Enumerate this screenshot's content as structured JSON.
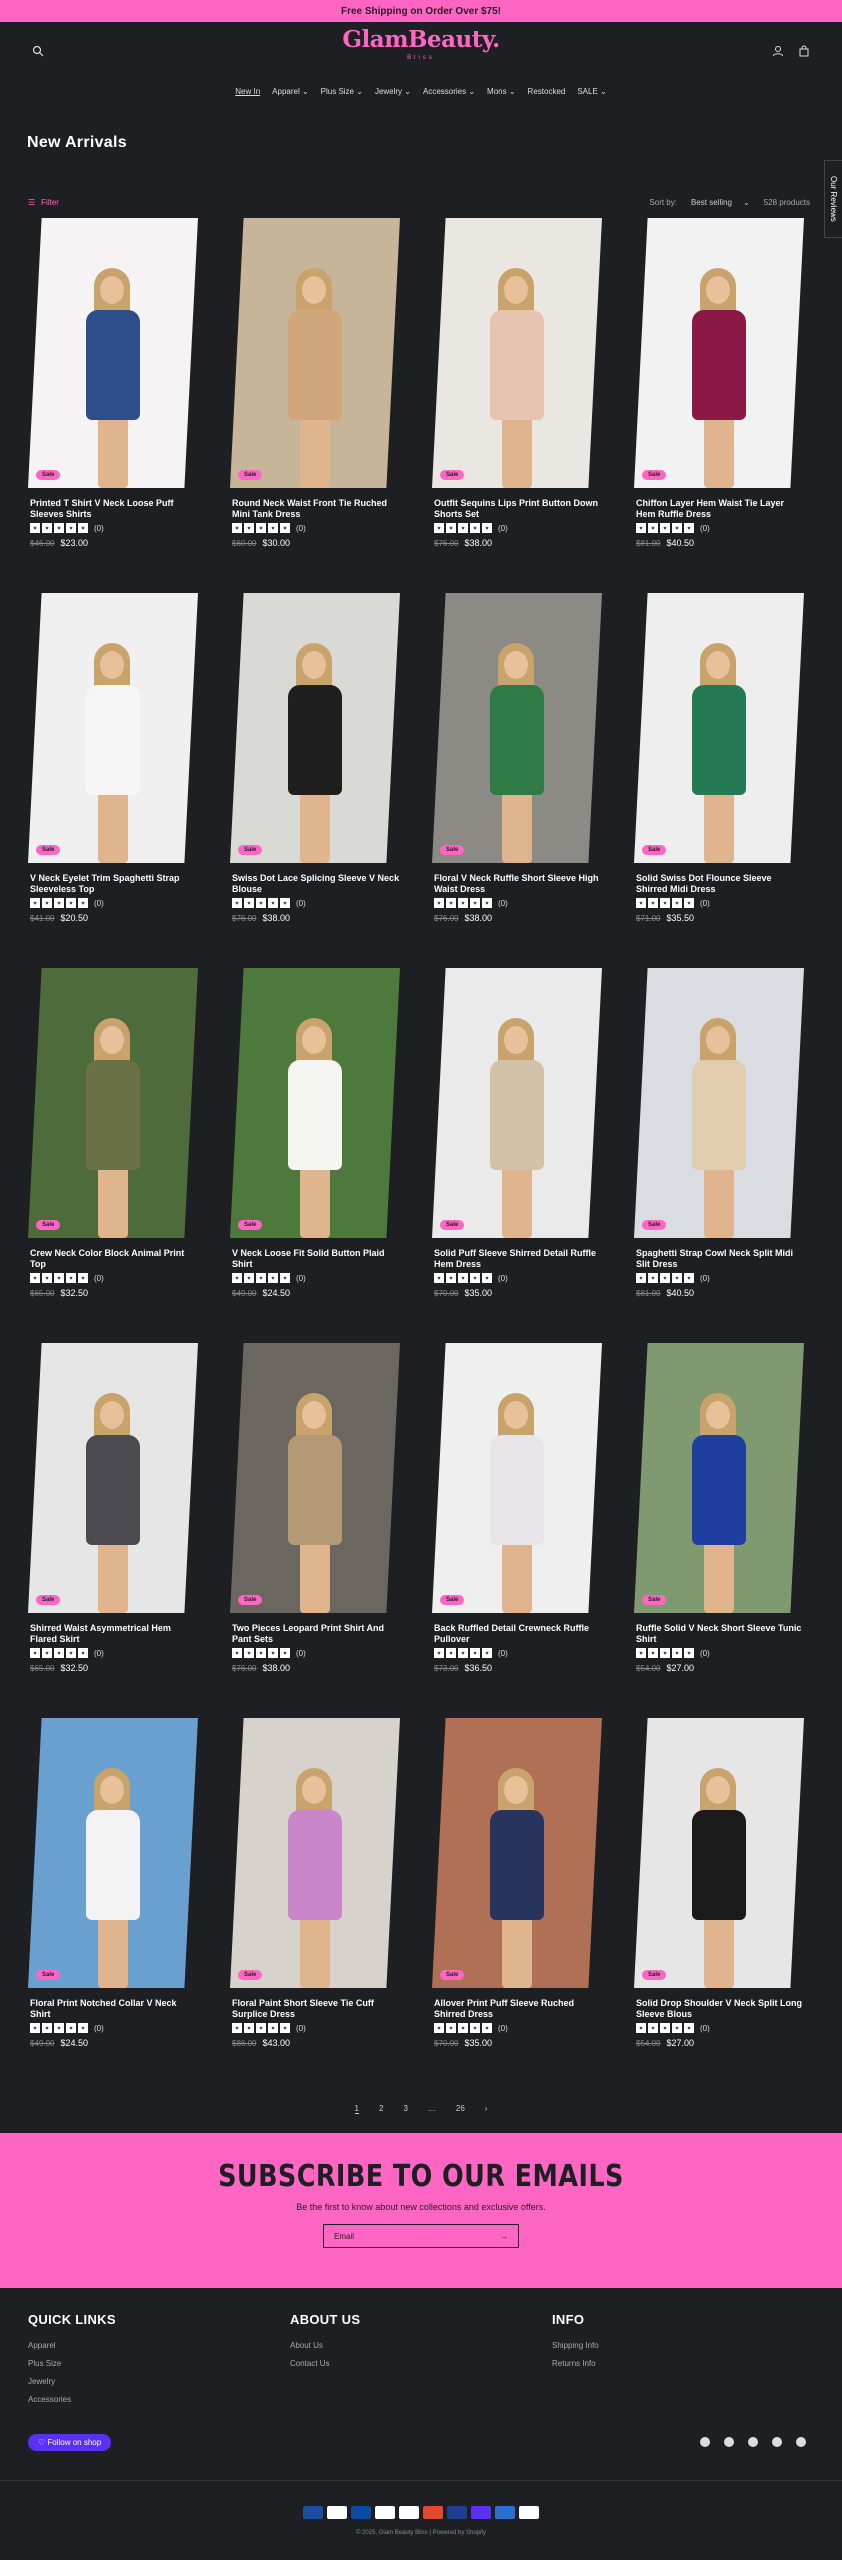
{
  "announcement": "Free Shipping on Order Over $75!",
  "brand": {
    "name": "GlamBeauty.",
    "tagline": "Bliss",
    "accent": "#ff66c4",
    "bg": "#1e1f22"
  },
  "nav": [
    "New In",
    "Apparel ⌄",
    "Plus Size ⌄",
    "Jewelry ⌄",
    "Accessories ⌄",
    "Mons ⌄",
    "Restocked",
    "SALE ⌄"
  ],
  "page_title": "New Arrivals",
  "filter_label": "Filter",
  "sort_label": "Sort by:",
  "sort_value": "Best selling",
  "product_count": "528 products",
  "reviews_tab": "Our Reviews",
  "products": [
    {
      "name": "Printed T Shirt V Neck Loose Puff Sleeves Shirts",
      "old": "$46.00",
      "new": "$23.00",
      "reviews": "(0)",
      "sale": "Sale",
      "color": "#f5f3f3",
      "garment": "#2d4e8a"
    },
    {
      "name": "Round Neck Waist Front Tie Ruched Mini Tank Dress",
      "old": "$60.00",
      "new": "$30.00",
      "reviews": "(0)",
      "sale": "Sale",
      "color": "#c7b59a",
      "garment": "#d2a67b"
    },
    {
      "name": "Outfit Sequins Lips Print Button Down Shorts Set",
      "old": "$76.00",
      "new": "$38.00",
      "reviews": "(0)",
      "sale": "Sale",
      "color": "#eae7e3",
      "garment": "#e6c4b1"
    },
    {
      "name": "Chiffon Layer Hem Waist Tie Layer Hem Ruffle Dress",
      "old": "$81.00",
      "new": "$40.50",
      "reviews": "(0)",
      "sale": "Sale",
      "color": "#f2f2f2",
      "garment": "#8a1a45"
    },
    {
      "name": "V Neck Eyelet Trim Spaghetti Strap Sleeveless Top",
      "old": "$41.00",
      "new": "$20.50",
      "reviews": "(0)",
      "sale": "Sale",
      "color": "#f0f0f0",
      "garment": "#f6f6f6"
    },
    {
      "name": "Swiss Dot Lace Splicing Sleeve V Neck Blouse",
      "old": "$76.00",
      "new": "$38.00",
      "reviews": "(0)",
      "sale": "Sale",
      "color": "#d9d9d5",
      "garment": "#1f1f1f"
    },
    {
      "name": "Floral V Neck Ruffle Short Sleeve High Waist Dress",
      "old": "$76.00",
      "new": "$38.00",
      "reviews": "(0)",
      "sale": "Sale",
      "color": "#8c8a85",
      "garment": "#2f7a45"
    },
    {
      "name": "Solid Swiss Dot Flounce Sleeve Shirred Midi Dress",
      "old": "$71.00",
      "new": "$35.50",
      "reviews": "(0)",
      "sale": "Sale",
      "color": "#eeeeee",
      "garment": "#237a55"
    },
    {
      "name": "Crew Neck Color Block Animal Print Top",
      "old": "$65.00",
      "new": "$32.50",
      "reviews": "(0)",
      "sale": "Sale",
      "color": "#4d6b3b",
      "garment": "#6b7146"
    },
    {
      "name": "V Neck Loose Fit Solid Button Plaid Shirt",
      "old": "$49.00",
      "new": "$24.50",
      "reviews": "(0)",
      "sale": "Sale",
      "color": "#4d7a3c",
      "garment": "#f5f5f2"
    },
    {
      "name": "Solid Puff Sleeve Shirred Detail Ruffle Hem Dress",
      "old": "$70.00",
      "new": "$35.00",
      "reviews": "(0)",
      "sale": "Sale",
      "color": "#eaeaea",
      "garment": "#d4c2a8"
    },
    {
      "name": "Spaghetti Strap Cowl Neck Split Midi Slit Dress",
      "old": "$81.00",
      "new": "$40.50",
      "reviews": "(0)",
      "sale": "Sale",
      "color": "#d9dde2",
      "garment": "#e2cdb0"
    },
    {
      "name": "Shirred Waist Asymmetrical Hem Flared Skirt",
      "old": "$65.00",
      "new": "$32.50",
      "reviews": "(0)",
      "sale": "Sale",
      "color": "#e6e6e6",
      "garment": "#4a4a50"
    },
    {
      "name": "Two Pieces Leopard Print Shirt And Pant Sets",
      "old": "$76.00",
      "new": "$38.00",
      "reviews": "(0)",
      "sale": "Sale",
      "color": "#6b6660",
      "garment": "#b49a74"
    },
    {
      "name": "Back Ruffled Detail Crewneck Ruffle Pullover",
      "old": "$73.00",
      "new": "$36.50",
      "reviews": "(0)",
      "sale": "Sale",
      "color": "#efefef",
      "garment": "#e8e6e9"
    },
    {
      "name": "Ruffle Solid V Neck Short Sleeve Tunic Shirt",
      "old": "$54.00",
      "new": "$27.00",
      "reviews": "(0)",
      "sale": "Sale",
      "color": "#7f9a70",
      "garment": "#1f3ea0"
    },
    {
      "name": "Floral Print Notched Collar V Neck Shirt",
      "old": "$49.00",
      "new": "$24.50",
      "reviews": "(0)",
      "sale": "Sale",
      "color": "#6aa0d0",
      "garment": "#f3f3f3"
    },
    {
      "name": "Floral Paint Short Sleeve Tie Cuff Surplice Dress",
      "old": "$86.00",
      "new": "$43.00",
      "reviews": "(0)",
      "sale": "Sale",
      "color": "#d7d3cc",
      "garment": "#c986c9"
    },
    {
      "name": "Allover Print Puff Sleeve Ruched Shirred Dress",
      "old": "$70.00",
      "new": "$35.00",
      "reviews": "(0)",
      "sale": "Sale",
      "color": "#b07055",
      "garment": "#27345e"
    },
    {
      "name": "Solid Drop Shoulder V Neck Split Long Sleeve Blous",
      "old": "$54.00",
      "new": "$27.00",
      "reviews": "(0)",
      "sale": "Sale",
      "color": "#e6e6e6",
      "garment": "#1a1a1a"
    }
  ],
  "pagination": [
    "1",
    "2",
    "3",
    "…",
    "26",
    "›"
  ],
  "subscribe": {
    "title": "SUBSCRIBE TO OUR EMAILS",
    "text": "Be the first to know about new collections and exclusive offers.",
    "placeholder": "Email",
    "arrow": "→"
  },
  "footer": {
    "quick_links": {
      "title": "QUICK LINKS",
      "items": [
        "Apparel",
        "Plus Size",
        "Jewelry",
        "Accessories"
      ]
    },
    "about": {
      "title": "ABOUT US",
      "items": [
        "About Us",
        "Contact Us"
      ]
    },
    "info": {
      "title": "INFO",
      "items": [
        "Shipping Info",
        "Returns Info"
      ]
    },
    "follow": "♡ Follow on shop",
    "copyright": "© 2025, Glam Beauty Bliss | Powered by Shopify"
  }
}
